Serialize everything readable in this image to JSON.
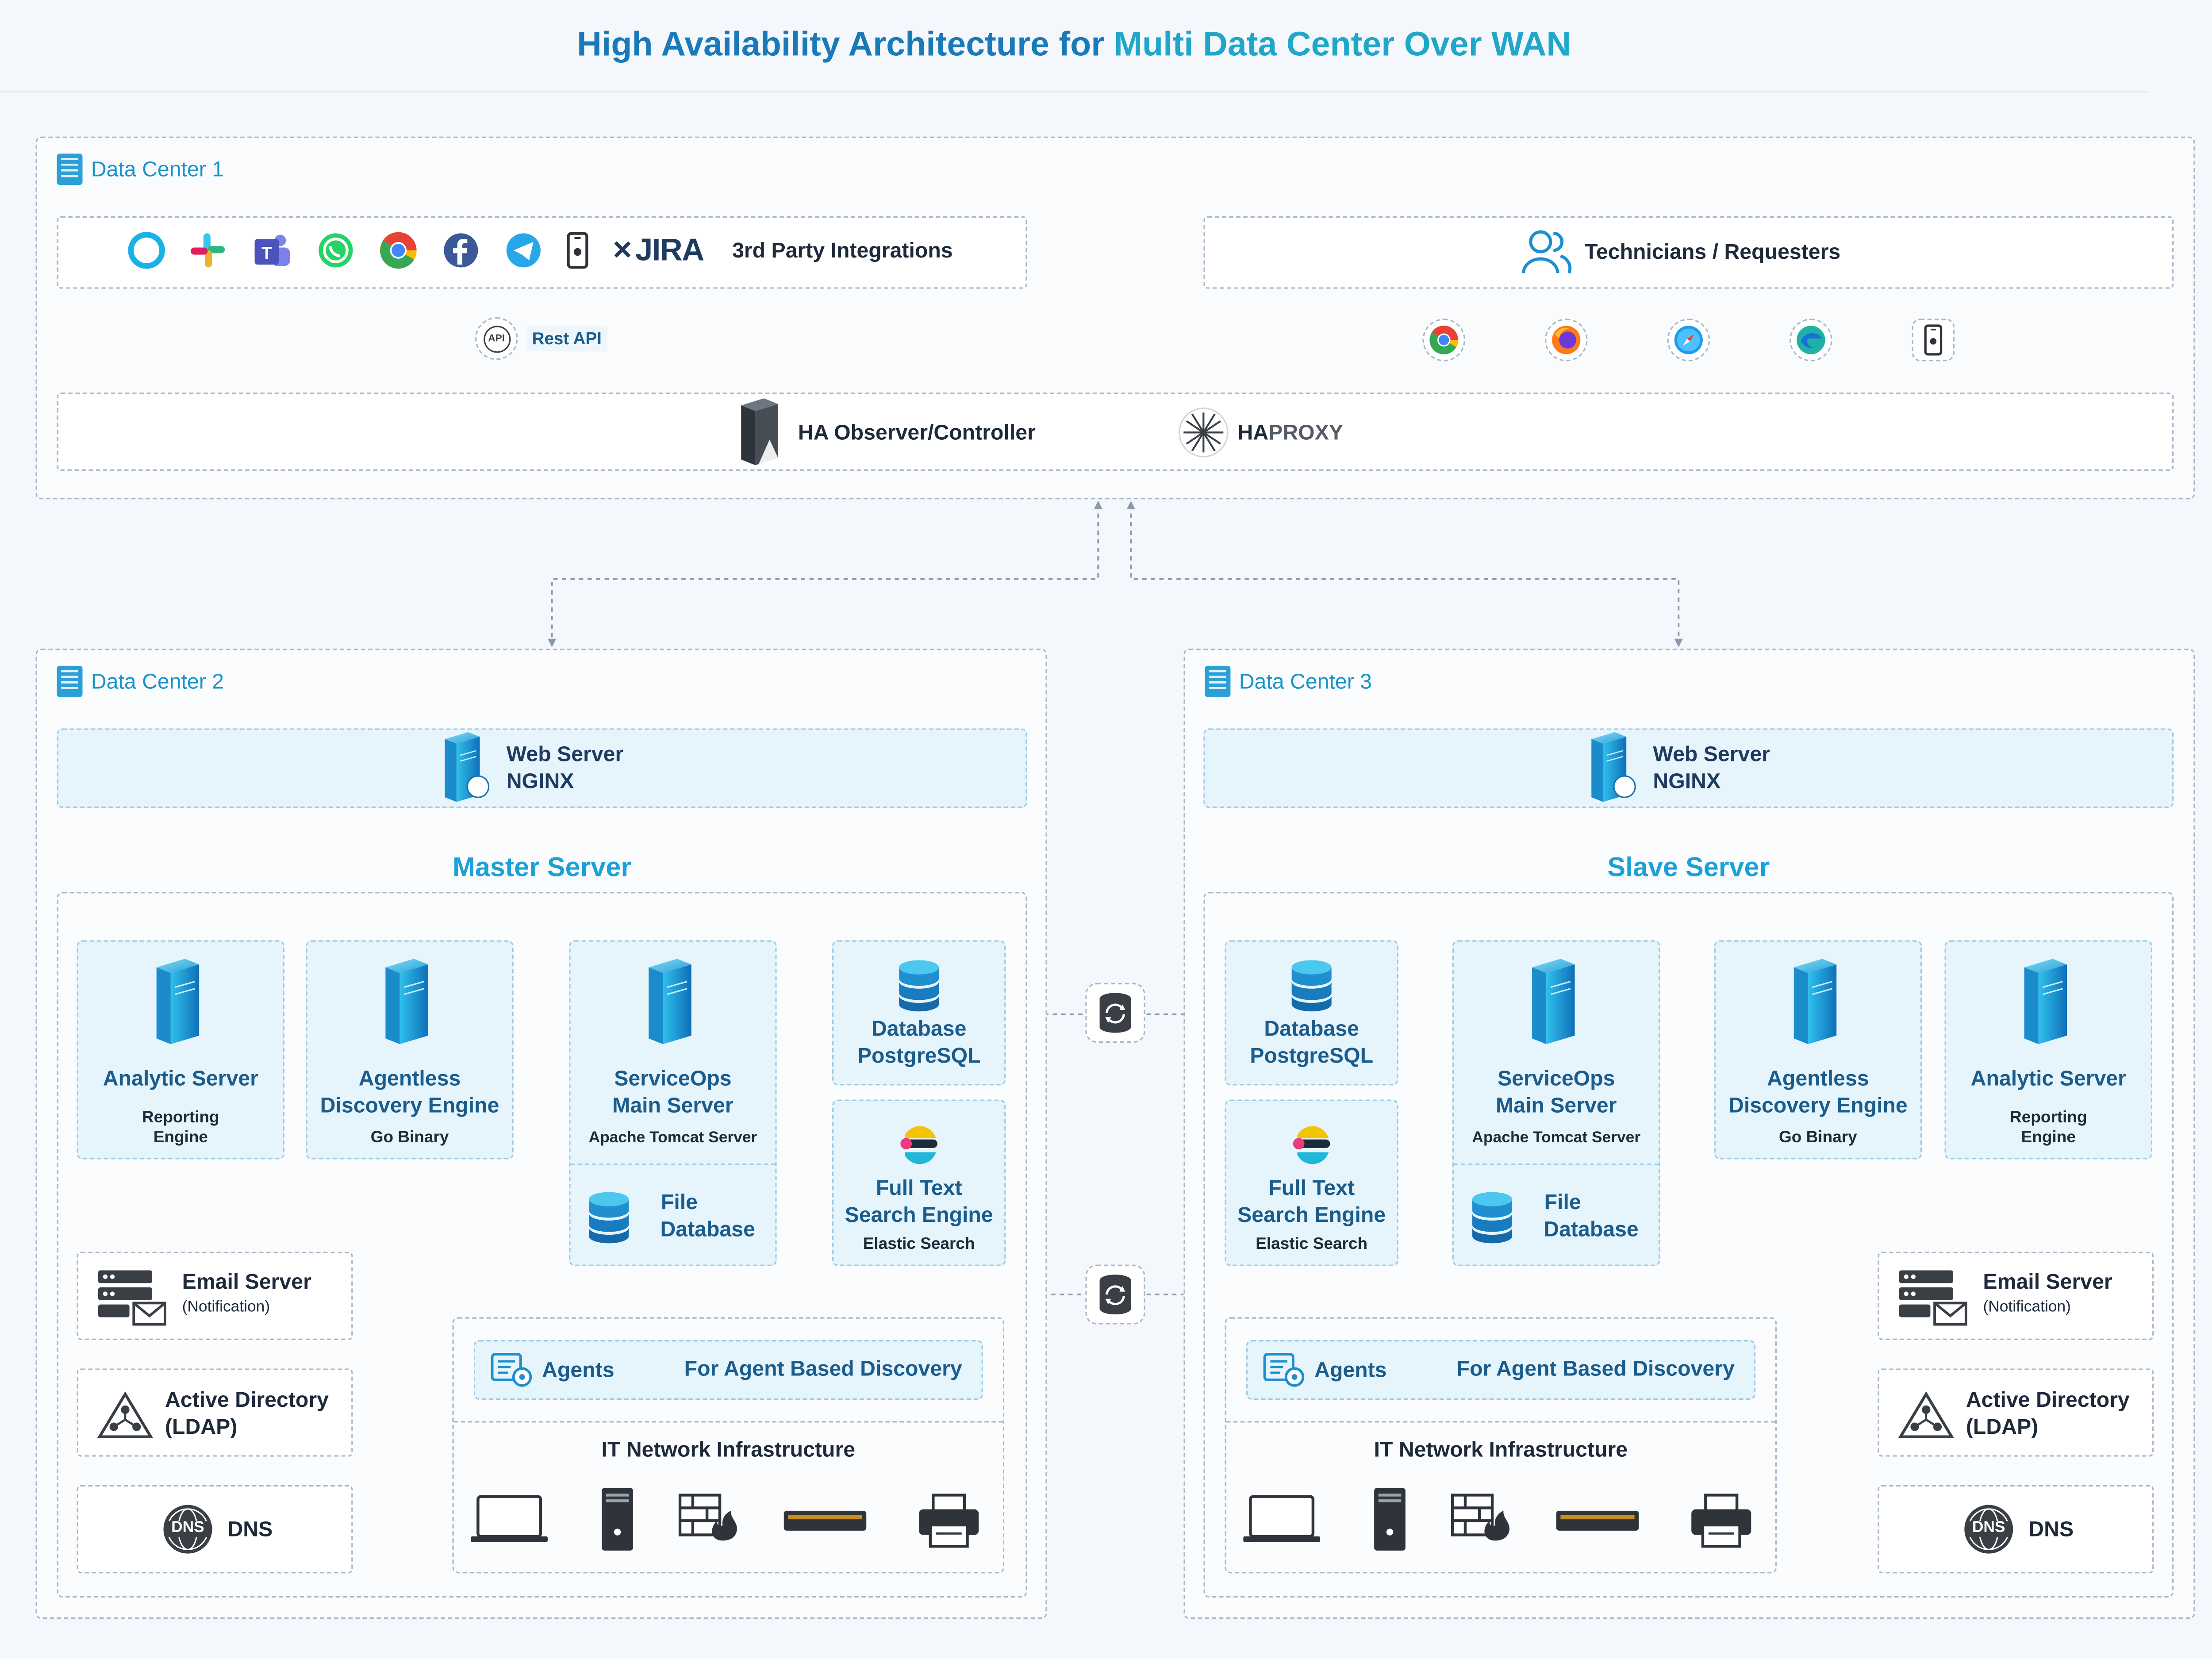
{
  "title": {
    "part1": "High Availability Architecture for ",
    "part2": "Multi Data Center Over WAN"
  },
  "dc1": {
    "label": "Data Center 1",
    "integrations": {
      "label": "3rd Party Integrations",
      "jira": "JIRA"
    },
    "technicians": {
      "label": "Technicians / Requesters"
    },
    "rest_api": "Rest API",
    "api_badge": "API",
    "ha": {
      "observer": "HA Observer/Controller",
      "haproxy_a": "HA",
      "haproxy_b": "PROXY"
    }
  },
  "dc2": {
    "label": "Data Center 2",
    "web": {
      "line1": "Web Server",
      "line2": "NGINX"
    },
    "section": "Master Server",
    "analytic": {
      "name": "Analytic Server",
      "sub1": "Reporting",
      "sub2": "Engine"
    },
    "agentless": {
      "line1": "Agentless",
      "line2": "Discovery Engine",
      "sub": "Go Binary"
    },
    "serviceops": {
      "line1": "ServiceOps",
      "line2": "Main Server",
      "sub": "Apache Tomcat Server"
    },
    "filedb": {
      "line1": "File",
      "line2": "Database"
    },
    "database": {
      "line1": "Database",
      "line2": "PostgreSQL"
    },
    "fulltext": {
      "line1": "Full Text",
      "line2": "Search Engine",
      "sub": "Elastic Search"
    },
    "email": {
      "name": "Email Server",
      "sub": "(Notification)"
    },
    "ad": {
      "line1": "Active Directory",
      "line2": "(LDAP)"
    },
    "dns": {
      "name": "DNS",
      "badge": "DNS"
    },
    "agents": {
      "label": "Agents",
      "desc": "For Agent Based Discovery"
    },
    "itnet": "IT Network Infrastructure"
  },
  "dc3": {
    "label": "Data Center 3",
    "web": {
      "line1": "Web Server",
      "line2": "NGINX"
    },
    "section": "Slave Server",
    "database": {
      "line1": "Database",
      "line2": "PostgreSQL"
    },
    "fulltext": {
      "line1": "Full Text",
      "line2": "Search Engine",
      "sub": "Elastic Search"
    },
    "serviceops": {
      "line1": "ServiceOps",
      "line2": "Main Server",
      "sub": "Apache Tomcat Server"
    },
    "filedb": {
      "line1": "File",
      "line2": "Database"
    },
    "agentless": {
      "line1": "Agentless",
      "line2": "Discovery Engine",
      "sub": "Go Binary"
    },
    "analytic": {
      "name": "Analytic Server",
      "sub1": "Reporting",
      "sub2": "Engine"
    },
    "email": {
      "name": "Email Server",
      "sub": "(Notification)"
    },
    "ad": {
      "line1": "Active Directory",
      "line2": "(LDAP)"
    },
    "dns": {
      "name": "DNS",
      "badge": "DNS"
    },
    "agents": {
      "label": "Agents",
      "desc": "For Agent Based Discovery"
    },
    "itnet": "IT Network Infrastructure"
  },
  "colors": {
    "accent": "#1ca0d8",
    "title": "#1a79b8",
    "dash": "#a9b6c6",
    "box_fill": "#e6f4fc"
  },
  "icons": [
    "alexa-icon",
    "slack-icon",
    "teams-icon",
    "whatsapp-icon",
    "chrome-icon",
    "facebook-icon",
    "telegram-icon",
    "mobile-icon",
    "jira-icon",
    "users-icon",
    "firefox-icon",
    "safari-icon",
    "edge-icon",
    "server-tower-icon",
    "haproxy-icon",
    "database-icon",
    "elastic-icon",
    "sync-icon",
    "email-server-icon",
    "ldap-icon",
    "dns-icon",
    "agents-icon",
    "laptop-icon",
    "pc-icon",
    "firewall-icon",
    "switch-icon",
    "printer-icon"
  ]
}
